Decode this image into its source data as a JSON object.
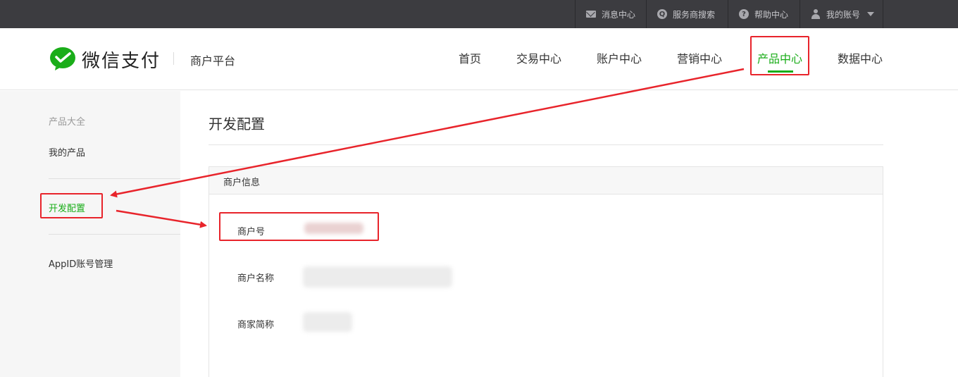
{
  "topbar": {
    "items": [
      {
        "label": "消息中心",
        "icon": "mail-icon"
      },
      {
        "label": "服务商搜索",
        "icon": "search-icon"
      },
      {
        "label": "帮助中心",
        "icon": "help-icon"
      },
      {
        "label": "我的账号",
        "icon": "user-icon"
      }
    ]
  },
  "header": {
    "logo_text": "微信支付",
    "subtitle": "商户平台",
    "nav": [
      "首页",
      "交易中心",
      "账户中心",
      "营销中心",
      "产品中心",
      "数据中心"
    ],
    "active_nav": "产品中心"
  },
  "sidebar": {
    "heading": "产品大全",
    "items": [
      "我的产品",
      "开发配置",
      "AppID账号管理"
    ],
    "active_item": "开发配置"
  },
  "main": {
    "title": "开发配置",
    "panel_title": "商户信息",
    "fields": [
      {
        "label": "商户号"
      },
      {
        "label": "商户名称"
      },
      {
        "label": "商家简称"
      }
    ]
  },
  "colors": {
    "accent": "#1aad19",
    "topbar": "#3c3c40",
    "annotation": "#e8242b"
  }
}
